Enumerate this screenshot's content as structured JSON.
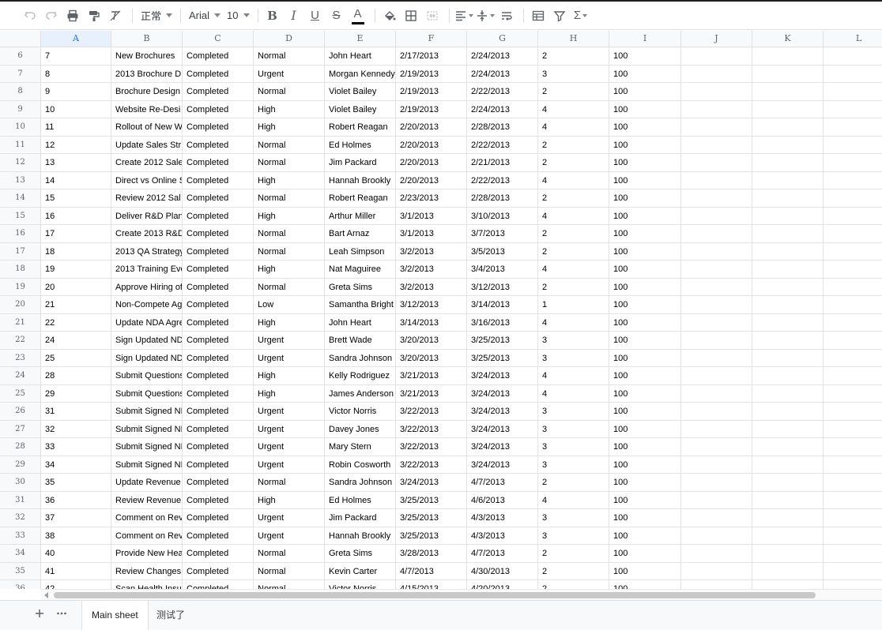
{
  "toolbar": {
    "undo_icon": "undo-icon",
    "redo_icon": "redo-icon",
    "style_value": "正常",
    "font_value": "Arial",
    "size_value": "10",
    "bold_label": "B",
    "italic_label": "I",
    "underline_label": "U",
    "strike_label": "S",
    "font_color_label": "A",
    "sum_label": "Σ"
  },
  "columns": [
    "A",
    "B",
    "C",
    "D",
    "E",
    "F",
    "G",
    "H",
    "I",
    "J",
    "K",
    "L"
  ],
  "selected_column": "A",
  "rows": [
    {
      "n": "6",
      "cells": [
        "7",
        "New Brochures",
        "Completed",
        "Normal",
        "John Heart",
        "2/17/2013",
        "2/24/2013",
        "2",
        "100",
        "",
        "",
        ""
      ]
    },
    {
      "n": "7",
      "cells": [
        "8",
        "2013 Brochure D",
        "Completed",
        "Urgent",
        "Morgan Kennedy",
        "2/19/2013",
        "2/24/2013",
        "3",
        "100",
        "",
        "",
        ""
      ]
    },
    {
      "n": "8",
      "cells": [
        "9",
        "Brochure Design",
        "Completed",
        "Normal",
        "Violet Bailey",
        "2/19/2013",
        "2/22/2013",
        "2",
        "100",
        "",
        "",
        ""
      ]
    },
    {
      "n": "9",
      "cells": [
        "10",
        "Website Re-Desi",
        "Completed",
        "High",
        "Violet Bailey",
        "2/19/2013",
        "2/24/2013",
        "4",
        "100",
        "",
        "",
        ""
      ]
    },
    {
      "n": "10",
      "cells": [
        "11",
        "Rollout of New W",
        "Completed",
        "High",
        "Robert Reagan",
        "2/20/2013",
        "2/28/2013",
        "4",
        "100",
        "",
        "",
        ""
      ]
    },
    {
      "n": "11",
      "cells": [
        "12",
        "Update Sales Str",
        "Completed",
        "Normal",
        "Ed Holmes",
        "2/20/2013",
        "2/22/2013",
        "2",
        "100",
        "",
        "",
        ""
      ]
    },
    {
      "n": "12",
      "cells": [
        "13",
        "Create 2012 Sale",
        "Completed",
        "Normal",
        "Jim Packard",
        "2/20/2013",
        "2/21/2013",
        "2",
        "100",
        "",
        "",
        ""
      ]
    },
    {
      "n": "13",
      "cells": [
        "14",
        "Direct vs Online S",
        "Completed",
        "High",
        "Hannah Brookly",
        "2/20/2013",
        "2/22/2013",
        "4",
        "100",
        "",
        "",
        ""
      ]
    },
    {
      "n": "14",
      "cells": [
        "15",
        "Review 2012 Sal",
        "Completed",
        "Normal",
        "Robert Reagan",
        "2/23/2013",
        "2/28/2013",
        "2",
        "100",
        "",
        "",
        ""
      ]
    },
    {
      "n": "15",
      "cells": [
        "16",
        "Deliver R&D Plan",
        "Completed",
        "High",
        "Arthur Miller",
        "3/1/2013",
        "3/10/2013",
        "4",
        "100",
        "",
        "",
        ""
      ]
    },
    {
      "n": "16",
      "cells": [
        "17",
        "Create 2013 R&D",
        "Completed",
        "Normal",
        "Bart Arnaz",
        "3/1/2013",
        "3/7/2013",
        "2",
        "100",
        "",
        "",
        ""
      ]
    },
    {
      "n": "17",
      "cells": [
        "18",
        "2013 QA Strategy",
        "Completed",
        "Normal",
        "Leah Simpson",
        "3/2/2013",
        "3/5/2013",
        "2",
        "100",
        "",
        "",
        ""
      ]
    },
    {
      "n": "18",
      "cells": [
        "19",
        "2013 Training Eve",
        "Completed",
        "High",
        "Nat Maguiree",
        "3/2/2013",
        "3/4/2013",
        "4",
        "100",
        "",
        "",
        ""
      ]
    },
    {
      "n": "19",
      "cells": [
        "20",
        "Approve Hiring of",
        "Completed",
        "Normal",
        "Greta Sims",
        "3/2/2013",
        "3/12/2013",
        "2",
        "100",
        "",
        "",
        ""
      ]
    },
    {
      "n": "20",
      "cells": [
        "21",
        "Non-Compete Ag",
        "Completed",
        "Low",
        "Samantha Bright",
        "3/12/2013",
        "3/14/2013",
        "1",
        "100",
        "",
        "",
        ""
      ]
    },
    {
      "n": "21",
      "cells": [
        "22",
        "Update NDA Agre",
        "Completed",
        "High",
        "John Heart",
        "3/14/2013",
        "3/16/2013",
        "4",
        "100",
        "",
        "",
        ""
      ]
    },
    {
      "n": "22",
      "cells": [
        "24",
        "Sign Updated ND",
        "Completed",
        "Urgent",
        "Brett Wade",
        "3/20/2013",
        "3/25/2013",
        "3",
        "100",
        "",
        "",
        ""
      ]
    },
    {
      "n": "23",
      "cells": [
        "25",
        "Sign Updated ND",
        "Completed",
        "Urgent",
        "Sandra Johnson",
        "3/20/2013",
        "3/25/2013",
        "3",
        "100",
        "",
        "",
        ""
      ]
    },
    {
      "n": "24",
      "cells": [
        "28",
        "Submit Questions",
        "Completed",
        "High",
        "Kelly Rodriguez",
        "3/21/2013",
        "3/24/2013",
        "4",
        "100",
        "",
        "",
        ""
      ]
    },
    {
      "n": "25",
      "cells": [
        "29",
        "Submit Questions",
        "Completed",
        "High",
        "James Anderson",
        "3/21/2013",
        "3/24/2013",
        "4",
        "100",
        "",
        "",
        ""
      ]
    },
    {
      "n": "26",
      "cells": [
        "31",
        "Submit Signed NI",
        "Completed",
        "Urgent",
        "Victor Norris",
        "3/22/2013",
        "3/24/2013",
        "3",
        "100",
        "",
        "",
        ""
      ]
    },
    {
      "n": "27",
      "cells": [
        "32",
        "Submit Signed NI",
        "Completed",
        "Urgent",
        "Davey Jones",
        "3/22/2013",
        "3/24/2013",
        "3",
        "100",
        "",
        "",
        ""
      ]
    },
    {
      "n": "28",
      "cells": [
        "33",
        "Submit Signed NI",
        "Completed",
        "Urgent",
        "Mary Stern",
        "3/22/2013",
        "3/24/2013",
        "3",
        "100",
        "",
        "",
        ""
      ]
    },
    {
      "n": "29",
      "cells": [
        "34",
        "Submit Signed NI",
        "Completed",
        "Urgent",
        "Robin Cosworth",
        "3/22/2013",
        "3/24/2013",
        "3",
        "100",
        "",
        "",
        ""
      ]
    },
    {
      "n": "30",
      "cells": [
        "35",
        "Update Revenue",
        "Completed",
        "Normal",
        "Sandra Johnson",
        "3/24/2013",
        "4/7/2013",
        "2",
        "100",
        "",
        "",
        ""
      ]
    },
    {
      "n": "31",
      "cells": [
        "36",
        "Review Revenue",
        "Completed",
        "High",
        "Ed Holmes",
        "3/25/2013",
        "4/6/2013",
        "4",
        "100",
        "",
        "",
        ""
      ]
    },
    {
      "n": "32",
      "cells": [
        "37",
        "Comment on Rev",
        "Completed",
        "Urgent",
        "Jim Packard",
        "3/25/2013",
        "4/3/2013",
        "3",
        "100",
        "",
        "",
        ""
      ]
    },
    {
      "n": "33",
      "cells": [
        "38",
        "Comment on Rev",
        "Completed",
        "Urgent",
        "Hannah Brookly",
        "3/25/2013",
        "4/3/2013",
        "3",
        "100",
        "",
        "",
        ""
      ]
    },
    {
      "n": "34",
      "cells": [
        "40",
        "Provide New Hea",
        "Completed",
        "Normal",
        "Greta Sims",
        "3/28/2013",
        "4/7/2013",
        "2",
        "100",
        "",
        "",
        ""
      ]
    },
    {
      "n": "35",
      "cells": [
        "41",
        "Review Changes",
        "Completed",
        "Normal",
        "Kevin Carter",
        "4/7/2013",
        "4/30/2013",
        "2",
        "100",
        "",
        "",
        ""
      ]
    },
    {
      "n": "36",
      "cells": [
        "42",
        "Scan Health Insu",
        "Completed",
        "Normal",
        "Victor Norris",
        "4/15/2013",
        "4/20/2013",
        "2",
        "100",
        "",
        "",
        ""
      ]
    }
  ],
  "sheet_tabs": [
    {
      "label": "Main sheet",
      "active": true
    },
    {
      "label": "测试了",
      "active": false
    }
  ],
  "colors": {
    "selected_header_bg": "#e8f0fe",
    "selected_header_text": "#1a73e8",
    "grid_line": "#e2e3e3"
  }
}
